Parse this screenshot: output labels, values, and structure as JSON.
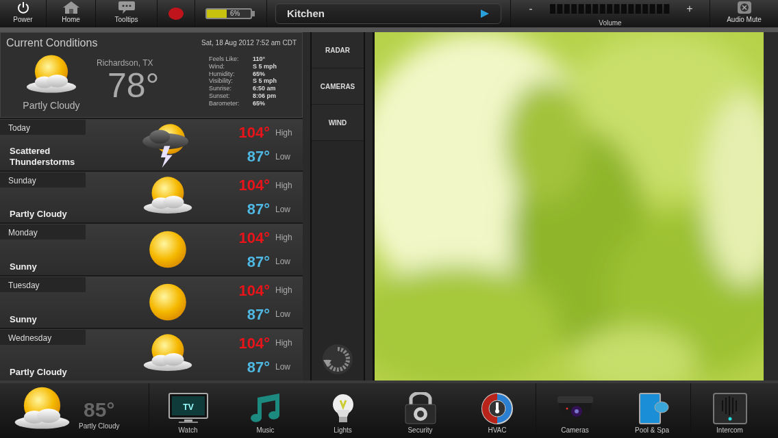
{
  "top_bar": {
    "buttons": [
      {
        "label": "Power",
        "kind": "power"
      },
      {
        "label": "Home",
        "kind": "home"
      },
      {
        "label": "Tooltips",
        "kind": "tooltips"
      }
    ],
    "battery": {
      "reading": "6%",
      "level": 0.46
    },
    "source": {
      "label": "Kitchen"
    },
    "volume": {
      "minus": "-",
      "plus": "+",
      "label": "Volume"
    },
    "mute": {
      "label": "Audio Mute"
    }
  },
  "current_conditions": {
    "title": "Current Conditions",
    "date": "Sat, 18 Aug 2012 7:52 am CDT",
    "location": "Richardson, TX",
    "temperature": "78°",
    "condition": "Partly Cloudy",
    "kind": "partly_cloudy",
    "details": [
      {
        "label": "Feels Like:",
        "value": "110°"
      },
      {
        "label": "Wind:",
        "value": "S 5 mph"
      },
      {
        "label": "Humidity:",
        "value": "65%"
      },
      {
        "label": "Visibility:",
        "value": "S 5 mph"
      },
      {
        "label": "Sunrise:",
        "value": "6:50 am"
      },
      {
        "label": "Sunset:",
        "value": "8:06 pm"
      },
      {
        "label": "Barometer:",
        "value": "65%"
      }
    ]
  },
  "forecast": [
    {
      "day": "Today",
      "condition": "Scattered Thunderstorms",
      "kind": "storm",
      "high": "104°",
      "high_label": "High",
      "low": "87°",
      "low_label": "Low"
    },
    {
      "day": "Sunday",
      "condition": "Partly Cloudy",
      "kind": "partly_cloudy",
      "high": "104°",
      "high_label": "High",
      "low": "87°",
      "low_label": "Low"
    },
    {
      "day": "Monday",
      "condition": "Sunny",
      "kind": "sunny",
      "high": "104°",
      "high_label": "High",
      "low": "87°",
      "low_label": "Low"
    },
    {
      "day": "Tuesday",
      "condition": "Sunny",
      "kind": "sunny",
      "high": "104°",
      "high_label": "High",
      "low": "87°",
      "low_label": "Low"
    },
    {
      "day": "Wednesday",
      "condition": "Partly Cloudy",
      "kind": "partly_cloudy",
      "high": "104°",
      "high_label": "High",
      "low": "87°",
      "low_label": "Low"
    }
  ],
  "side_tabs": [
    "RADAR",
    "CAMERAS",
    "WIND"
  ],
  "bottom_bar": {
    "weather": {
      "temperature": "85°",
      "condition": "Partly Cloudy",
      "kind": "partly_cloudy"
    },
    "nav": [
      {
        "label": "Watch",
        "kind": "tv",
        "icon_text": "TV"
      },
      {
        "label": "Music",
        "kind": "music"
      },
      {
        "label": "Lights",
        "kind": "bulb"
      },
      {
        "label": "Security",
        "kind": "lock"
      },
      {
        "label": "HVAC",
        "kind": "hvac"
      },
      {
        "label": "Cameras",
        "kind": "camera"
      },
      {
        "label": "Pool & Spa",
        "kind": "pool"
      },
      {
        "label": "Intercom",
        "kind": "intercom"
      }
    ]
  }
}
